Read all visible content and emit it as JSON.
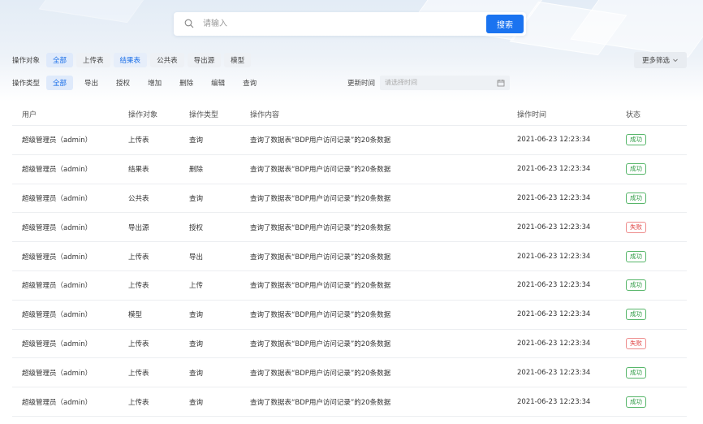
{
  "search": {
    "placeholder": "请输入",
    "button_label": "搜索"
  },
  "filters": {
    "object_label": "操作对象",
    "object_options": [
      "全部",
      "上传表",
      "结果表",
      "公共表",
      "导出源",
      "模型"
    ],
    "type_label": "操作类型",
    "type_options": [
      "全部",
      "导出",
      "授权",
      "增加",
      "删除",
      "编辑",
      "查询"
    ],
    "update_time_label": "更新时间",
    "date_placeholder": "请选择时间",
    "more_filter_label": "更多筛选"
  },
  "table": {
    "headers": {
      "user": "用户",
      "object": "操作对象",
      "type": "操作类型",
      "content": "操作内容",
      "time": "操作时间",
      "status": "状态"
    },
    "rows": [
      {
        "user": "超级管理员（admin）",
        "object": "上传表",
        "type": "查询",
        "content": "查询了数据表“BDP用户访问记录”的20条数据",
        "time": "2021-06-23 12:23:34",
        "status": "成功"
      },
      {
        "user": "超级管理员（admin）",
        "object": "结果表",
        "type": "删除",
        "content": "查询了数据表“BDP用户访问记录”的20条数据",
        "time": "2021-06-23 12:23:34",
        "status": "成功"
      },
      {
        "user": "超级管理员（admin）",
        "object": "公共表",
        "type": "查询",
        "content": "查询了数据表“BDP用户访问记录”的20条数据",
        "time": "2021-06-23 12:23:34",
        "status": "成功"
      },
      {
        "user": "超级管理员（admin）",
        "object": "导出源",
        "type": "授权",
        "content": "查询了数据表“BDP用户访问记录”的20条数据",
        "time": "2021-06-23 12:23:34",
        "status": "失败"
      },
      {
        "user": "超级管理员（admin）",
        "object": "上传表",
        "type": "导出",
        "content": "查询了数据表“BDP用户访问记录”的20条数据",
        "time": "2021-06-23 12:23:34",
        "status": "成功"
      },
      {
        "user": "超级管理员（admin）",
        "object": "上传表",
        "type": "上传",
        "content": "查询了数据表“BDP用户访问记录”的20条数据",
        "time": "2021-06-23 12:23:34",
        "status": "成功"
      },
      {
        "user": "超级管理员（admin）",
        "object": "模型",
        "type": "查询",
        "content": "查询了数据表“BDP用户访问记录”的20条数据",
        "time": "2021-06-23 12:23:34",
        "status": "成功"
      },
      {
        "user": "超级管理员（admin）",
        "object": "上传表",
        "type": "查询",
        "content": "查询了数据表“BDP用户访问记录”的20条数据",
        "time": "2021-06-23 12:23:34",
        "status": "失败"
      },
      {
        "user": "超级管理员（admin）",
        "object": "上传表",
        "type": "查询",
        "content": "查询了数据表“BDP用户访问记录”的20条数据",
        "time": "2021-06-23 12:23:34",
        "status": "成功"
      },
      {
        "user": "超级管理员（admin）",
        "object": "上传表",
        "type": "查询",
        "content": "查询了数据表“BDP用户访问记录”的20条数据",
        "time": "2021-06-23 12:23:34",
        "status": "成功"
      }
    ]
  },
  "colors": {
    "accent": "#1a73f0",
    "success": "#2f9b45",
    "failure": "#e04848"
  }
}
